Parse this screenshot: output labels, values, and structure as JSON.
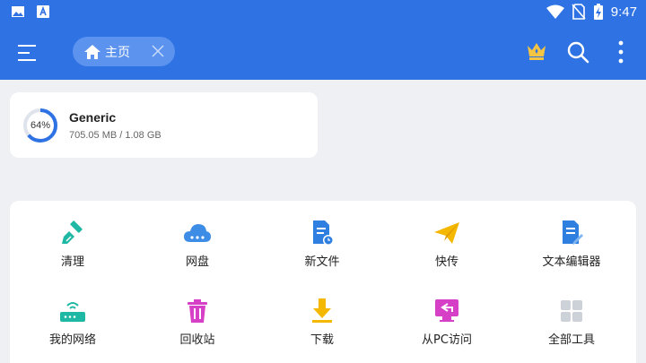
{
  "status_bar": {
    "time": "9:47"
  },
  "app_bar": {
    "tab_label": "主页"
  },
  "storage": {
    "name": "Generic",
    "percent_label": "64%",
    "percent": 64,
    "size": "705.05 MB / 1.08 GB"
  },
  "tools": [
    {
      "label": "清理",
      "icon": "broom-icon"
    },
    {
      "label": "网盘",
      "icon": "cloud-icon"
    },
    {
      "label": "新文件",
      "icon": "new-file-icon"
    },
    {
      "label": "快传",
      "icon": "paper-plane-icon"
    },
    {
      "label": "文本编辑器",
      "icon": "text-editor-icon"
    },
    {
      "label": "我的网络",
      "icon": "router-icon"
    },
    {
      "label": "回收站",
      "icon": "trash-icon"
    },
    {
      "label": "下载",
      "icon": "download-icon"
    },
    {
      "label": "从PC访问",
      "icon": "pc-access-icon"
    },
    {
      "label": "全部工具",
      "icon": "grid-icon"
    }
  ],
  "colors": {
    "primary": "#2f72e4",
    "ring": "#2f72e4",
    "card": "#ffffff",
    "background": "#eff0f3"
  }
}
